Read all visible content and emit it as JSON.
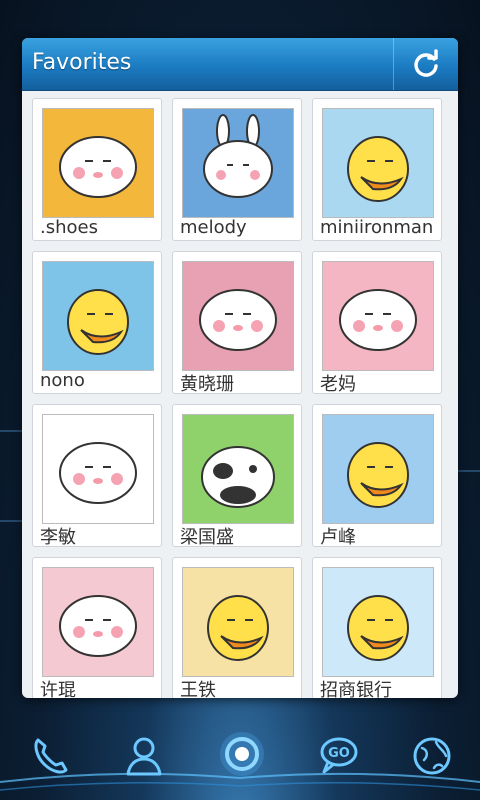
{
  "widget": {
    "title": "Favorites"
  },
  "contacts": [
    {
      "name": ".shoes",
      "bg": "#f2b73b",
      "character": "pig"
    },
    {
      "name": "melody",
      "bg": "#6aa6dc",
      "character": "rabbit"
    },
    {
      "name": "miniironman",
      "bg": "#a9d8f0",
      "character": "duck"
    },
    {
      "name": "nono",
      "bg": "#7ec3e8",
      "character": "duck"
    },
    {
      "name": "黄晓珊",
      "bg": "#e8a1b3",
      "character": "pig"
    },
    {
      "name": "老妈",
      "bg": "#f4b6c2",
      "character": "pig"
    },
    {
      "name": "李敏",
      "bg": "#ffffff",
      "character": "pig"
    },
    {
      "name": "梁国盛",
      "bg": "#8fd16a",
      "character": "cow"
    },
    {
      "name": "卢峰",
      "bg": "#9fcdf0",
      "character": "duck"
    },
    {
      "name": "许琨",
      "bg": "#f5c9d2",
      "character": "pig"
    },
    {
      "name": "王铁",
      "bg": "#f7e2a6",
      "character": "duck"
    },
    {
      "name": "招商银行",
      "bg": "#cde8f8",
      "character": "duck"
    }
  ],
  "dock": {
    "icons": [
      "phone-icon",
      "contacts-icon",
      "app-drawer-icon",
      "messaging-icon",
      "browser-icon"
    ]
  },
  "colors": {
    "header": "#1b7bc2",
    "accent": "#38a8ff"
  }
}
